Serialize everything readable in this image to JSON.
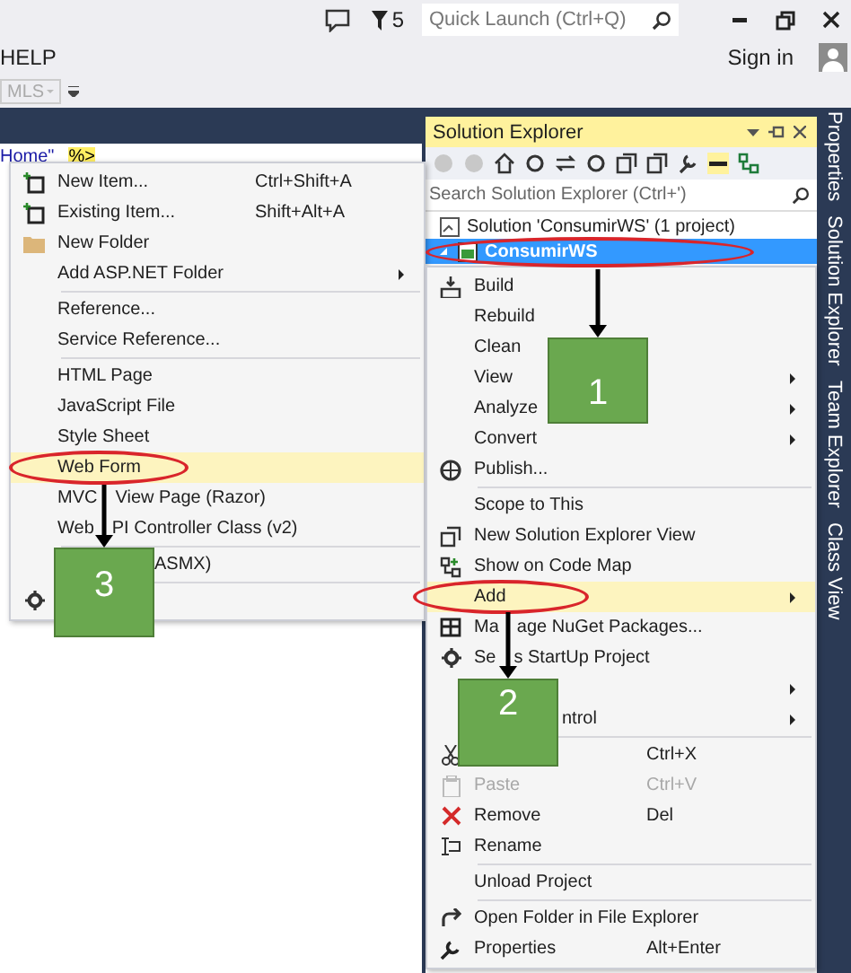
{
  "title_bar": {
    "notifications_count": "5",
    "quick_launch": {
      "placeholder": "Quick Launch (Ctrl+Q)"
    }
  },
  "menu_bar": {
    "items": [
      "HELP"
    ],
    "sign_in": "Sign in"
  },
  "toolbar": {
    "dropdown": "MLS"
  },
  "editor": {
    "code_tokens": [
      {
        "kind": "string",
        "text": "Home\""
      },
      {
        "kind": "directive",
        "text": "%>"
      }
    ]
  },
  "add_menu": {
    "items": [
      {
        "kind": "item",
        "label": "New Item...",
        "shortcut": "Ctrl+Shift+A",
        "submenu": false,
        "selected": false
      },
      {
        "kind": "item",
        "label": "Existing Item...",
        "shortcut": "Shift+Alt+A",
        "submenu": false,
        "selected": false
      },
      {
        "kind": "item",
        "label": "New Folder",
        "submenu": false,
        "selected": false
      },
      {
        "kind": "item",
        "label": "Add ASP.NET Folder",
        "submenu": true,
        "selected": false
      },
      {
        "kind": "separator"
      },
      {
        "kind": "item",
        "label": "Reference...",
        "submenu": false,
        "selected": false
      },
      {
        "kind": "item",
        "label": "Service Reference...",
        "submenu": false,
        "selected": false
      },
      {
        "kind": "separator"
      },
      {
        "kind": "item",
        "label": "HTML Page",
        "submenu": false,
        "selected": false
      },
      {
        "kind": "item",
        "label": "JavaScript File",
        "submenu": false,
        "selected": false
      },
      {
        "kind": "item",
        "label": "Style Sheet",
        "submenu": false,
        "selected": false
      },
      {
        "kind": "item",
        "label": "Web Form",
        "submenu": false,
        "selected": true
      },
      {
        "kind": "split",
        "label_parts": [
          "MVC",
          "View Page (Razor)"
        ],
        "submenu": false,
        "selected": false
      },
      {
        "kind": "split",
        "label_parts": [
          "Web",
          "PI Controller Class (v2)"
        ],
        "submenu": false,
        "selected": false
      },
      {
        "kind": "separator"
      },
      {
        "kind": "partial",
        "label": "ASMX)",
        "submenu": false,
        "selected": false
      },
      {
        "kind": "separator"
      },
      {
        "kind": "covered"
      }
    ]
  },
  "solution_explorer": {
    "title": "Solution Explorer",
    "search": {
      "placeholder": "Search Solution Explorer (Ctrl+')"
    },
    "tree": [
      {
        "label": "Solution 'ConsumirWS' (1 project)",
        "selected": false,
        "children": [
          {
            "label": "ConsumirWS",
            "selected": true,
            "expanded": true
          }
        ]
      }
    ]
  },
  "context_menu": {
    "items": [
      {
        "kind": "item",
        "label": "Build",
        "submenu": false,
        "selected": false,
        "disabled": false
      },
      {
        "kind": "item",
        "label": "Rebuild",
        "submenu": false,
        "selected": false,
        "disabled": false
      },
      {
        "kind": "item",
        "label": "Clean",
        "submenu": false,
        "selected": false,
        "disabled": false
      },
      {
        "kind": "item",
        "label": "View",
        "submenu": true,
        "selected": false,
        "disabled": false
      },
      {
        "kind": "item",
        "label": "Analyze",
        "submenu": true,
        "selected": false,
        "disabled": false
      },
      {
        "kind": "item",
        "label": "Convert",
        "submenu": true,
        "selected": false,
        "disabled": false
      },
      {
        "kind": "item",
        "label": "Publish...",
        "submenu": false,
        "selected": false,
        "disabled": false
      },
      {
        "kind": "separator"
      },
      {
        "kind": "item",
        "label": "Scope to This",
        "submenu": false,
        "selected": false,
        "disabled": false
      },
      {
        "kind": "item",
        "label": "New Solution Explorer View",
        "submenu": false,
        "selected": false,
        "disabled": false
      },
      {
        "kind": "item",
        "label": "Show on Code Map",
        "submenu": false,
        "selected": false,
        "disabled": false
      },
      {
        "kind": "item",
        "label": "Add",
        "submenu": true,
        "selected": true,
        "disabled": false
      },
      {
        "kind": "split",
        "label_parts": [
          "Ma",
          "age NuGet Packages..."
        ],
        "submenu": false,
        "selected": false,
        "disabled": false
      },
      {
        "kind": "split",
        "label_parts": [
          "Se",
          "s StartUp Project"
        ],
        "submenu": false,
        "selected": false,
        "disabled": false
      },
      {
        "kind": "covered",
        "submenu": true
      },
      {
        "kind": "partial",
        "label": "ntrol",
        "submenu": true,
        "selected": false,
        "disabled": false
      },
      {
        "kind": "separator"
      },
      {
        "kind": "covered",
        "shortcut": "Ctrl+X"
      },
      {
        "kind": "item",
        "label": "Paste",
        "shortcut": "Ctrl+V",
        "submenu": false,
        "selected": false,
        "disabled": true
      },
      {
        "kind": "item",
        "label": "Remove",
        "shortcut": "Del",
        "submenu": false,
        "selected": false,
        "disabled": false
      },
      {
        "kind": "item",
        "label": "Rename",
        "submenu": false,
        "selected": false,
        "disabled": false
      },
      {
        "kind": "separator"
      },
      {
        "kind": "item",
        "label": "Unload Project",
        "submenu": false,
        "selected": false,
        "disabled": false
      },
      {
        "kind": "separator"
      },
      {
        "kind": "item",
        "label": "Open Folder in File Explorer",
        "submenu": false,
        "selected": false,
        "disabled": false
      },
      {
        "kind": "item",
        "label": "Properties",
        "shortcut": "Alt+Enter",
        "submenu": false,
        "selected": false,
        "disabled": false
      }
    ]
  },
  "side_tabs": [
    "Properties",
    "Solution Explorer",
    "Team Explorer",
    "Class View"
  ],
  "annotations": [
    {
      "kind": "ellipse"
    },
    {
      "kind": "arrow"
    },
    {
      "kind": "step",
      "label": "1"
    },
    {
      "kind": "ellipse"
    },
    {
      "kind": "arrow"
    },
    {
      "kind": "step",
      "label": "2"
    },
    {
      "kind": "ellipse"
    },
    {
      "kind": "arrow"
    },
    {
      "kind": "step",
      "label": "3"
    }
  ]
}
